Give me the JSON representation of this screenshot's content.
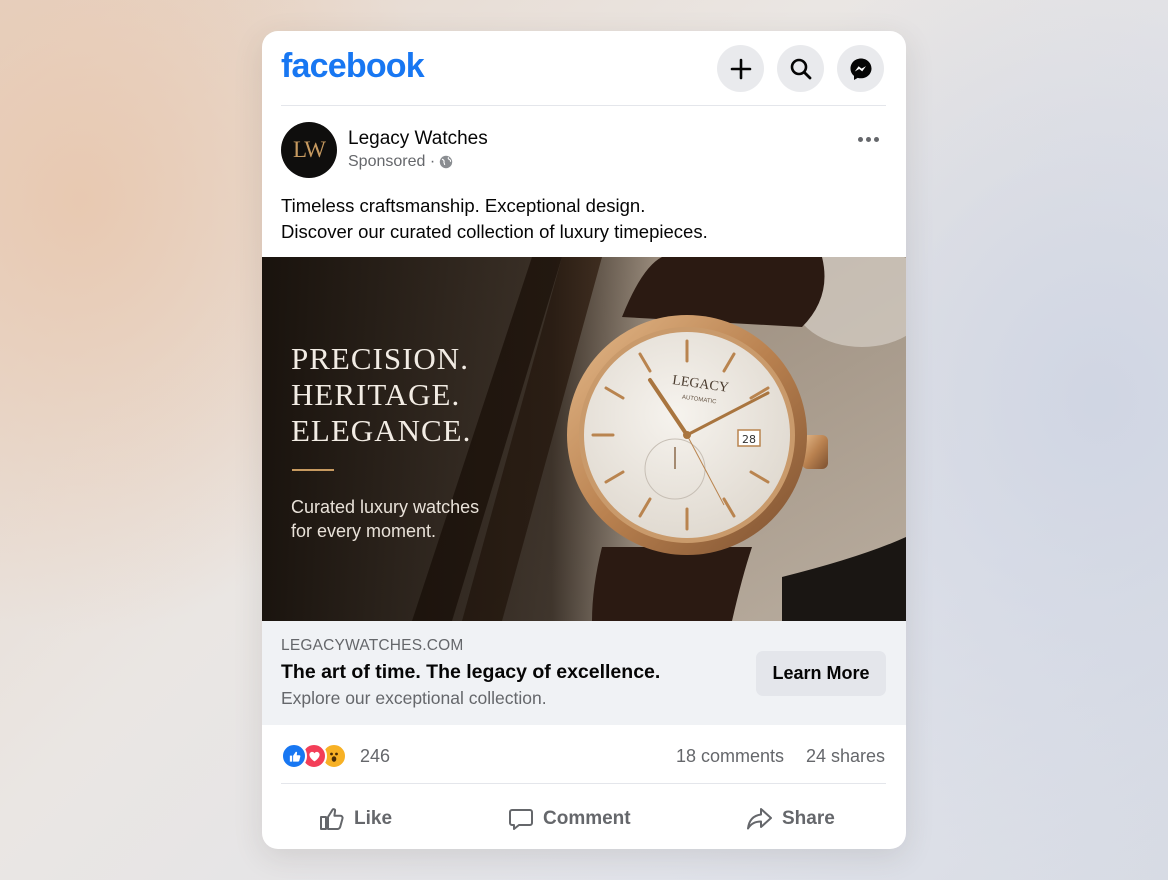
{
  "header": {
    "brand": "facebook",
    "icons": [
      "plus-icon",
      "search-icon",
      "messenger-icon"
    ]
  },
  "post": {
    "avatar_initials": "LW",
    "page_name": "Legacy Watches",
    "sponsored_label": "Sponsored ·",
    "text_line1": "Timeless craftsmanship. Exceptional design.",
    "text_line2": "Discover our curated collection of luxury timepieces."
  },
  "creative": {
    "title_line1": "PRECISION.",
    "title_line2": "HERITAGE.",
    "title_line3": "ELEGANCE.",
    "sub_line1": "Curated luxury watches",
    "sub_line2": "for every moment.",
    "watch_brand": "LEGACY",
    "watch_model": "AUTOMATIC",
    "watch_date": "28"
  },
  "link": {
    "domain": "LEGACYWATCHES.COM",
    "headline": "The art of time. The legacy of excellence.",
    "description": "Explore our exceptional collection.",
    "cta": "Learn More"
  },
  "stats": {
    "reaction_count": "246",
    "comments": "18 comments",
    "shares": "24 shares"
  },
  "actions": {
    "like": "Like",
    "comment": "Comment",
    "share": "Share"
  },
  "colors": {
    "brand": "#1877f2",
    "accent_gold": "#c79a60",
    "love": "#f33e58",
    "wow": "#f7b125"
  }
}
